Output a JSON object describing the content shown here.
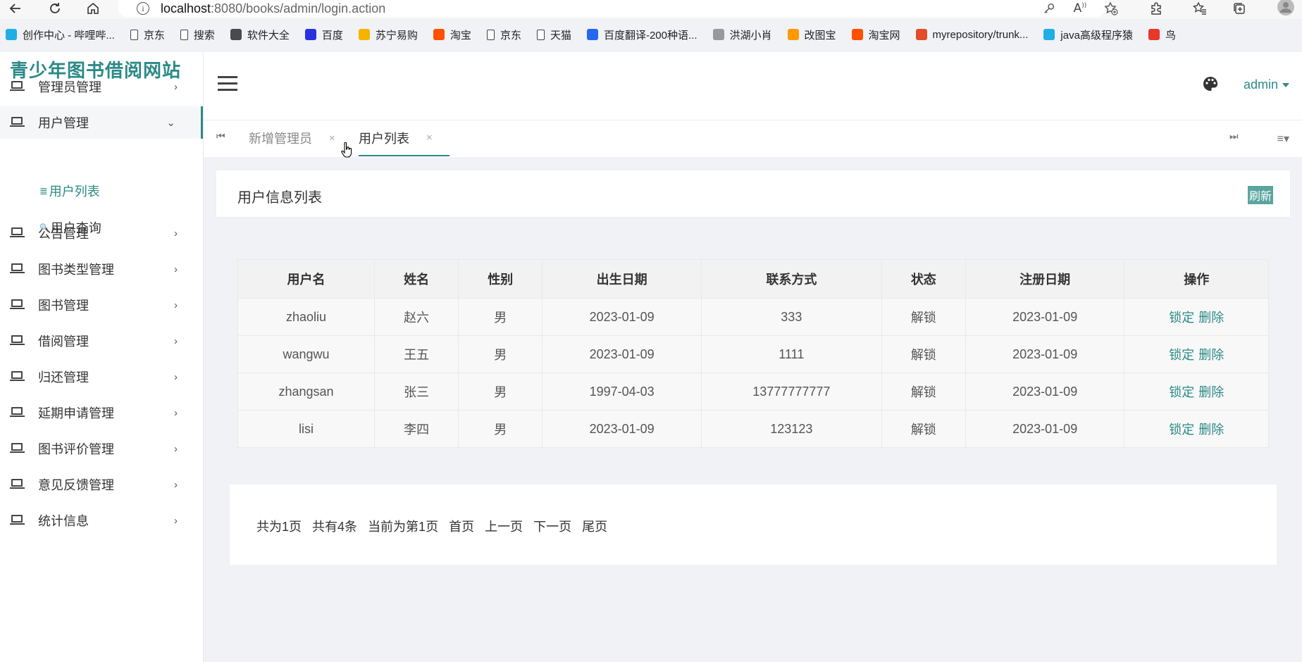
{
  "browser": {
    "url_host": "localhost",
    "url_rest": ":8080/books/admin/login.action",
    "bookmarks": [
      {
        "label": "创作中心 - 哔哩哔...",
        "color": "#23ade5"
      },
      {
        "label": "京东",
        "color": "page"
      },
      {
        "label": "搜索",
        "color": "page"
      },
      {
        "label": "软件大全",
        "color": "#4a4a4a"
      },
      {
        "label": "百度",
        "color": "#2932e1"
      },
      {
        "label": "苏宁易购",
        "color": "#f4b400"
      },
      {
        "label": "淘宝",
        "color": "#ff5000"
      },
      {
        "label": "京东",
        "color": "page"
      },
      {
        "label": "天猫",
        "color": "page"
      },
      {
        "label": "百度翻译-200种语...",
        "color": "#2468f2"
      },
      {
        "label": "洪湖小肖",
        "color": "#999999"
      },
      {
        "label": "改图宝",
        "color": "#ff9900"
      },
      {
        "label": "淘宝网",
        "color": "#ff5000"
      },
      {
        "label": "myrepository/trunk...",
        "color": "#e34c26"
      },
      {
        "label": "java高级程序猿",
        "color": "#23ade5"
      },
      {
        "label": "鸟",
        "color": "#e83828"
      }
    ]
  },
  "sidebar": {
    "site_title": "青少年图书借阅网站",
    "menu": [
      {
        "label": "管理员管理",
        "arrow": "›"
      },
      {
        "label": "用户管理",
        "arrow": "⌄"
      },
      {
        "label": "公告管理",
        "arrow": "›"
      },
      {
        "label": "图书类型管理",
        "arrow": "›"
      },
      {
        "label": "图书管理",
        "arrow": "›"
      },
      {
        "label": "借阅管理",
        "arrow": "›"
      },
      {
        "label": "归还管理",
        "arrow": "›"
      },
      {
        "label": "延期申请管理",
        "arrow": "›"
      },
      {
        "label": "图书评价管理",
        "arrow": "›"
      },
      {
        "label": "意见反馈管理",
        "arrow": "›"
      },
      {
        "label": "统计信息",
        "arrow": "›"
      }
    ],
    "submenu": [
      {
        "icon": "≣",
        "label": "用户列表"
      },
      {
        "icon": "🔍",
        "label": "用户查询"
      }
    ]
  },
  "header": {
    "user": "admin"
  },
  "tabs": [
    {
      "label": "新增管理员",
      "close": "×"
    },
    {
      "label": "用户列表",
      "close": "×"
    }
  ],
  "panel": {
    "title": "用户信息列表",
    "refresh": "刷新"
  },
  "table": {
    "headers": [
      "用户名",
      "姓名",
      "性别",
      "出生日期",
      "联系方式",
      "状态",
      "注册日期",
      "操作"
    ],
    "rows": [
      [
        "zhaoliu",
        "赵六",
        "男",
        "2023-01-09",
        "333",
        "解锁",
        "2023-01-09"
      ],
      [
        "wangwu",
        "王五",
        "男",
        "2023-01-09",
        "1111",
        "解锁",
        "2023-01-09"
      ],
      [
        "zhangsan",
        "张三",
        "男",
        "1997-04-03",
        "13777777777",
        "解锁",
        "2023-01-09"
      ],
      [
        "lisi",
        "李四",
        "男",
        "2023-01-09",
        "123123",
        "解锁",
        "2023-01-09"
      ]
    ],
    "actions": [
      "锁定",
      "删除"
    ]
  },
  "pager": {
    "total_pages": "共为1页",
    "total_items": "共有4条",
    "current": "当前为第1页",
    "first": "首页",
    "prev": "上一页",
    "next": "下一页",
    "last": "尾页"
  },
  "colors": {
    "accent": "#2b8a87",
    "refresh_bg": "#5aa5a0"
  }
}
